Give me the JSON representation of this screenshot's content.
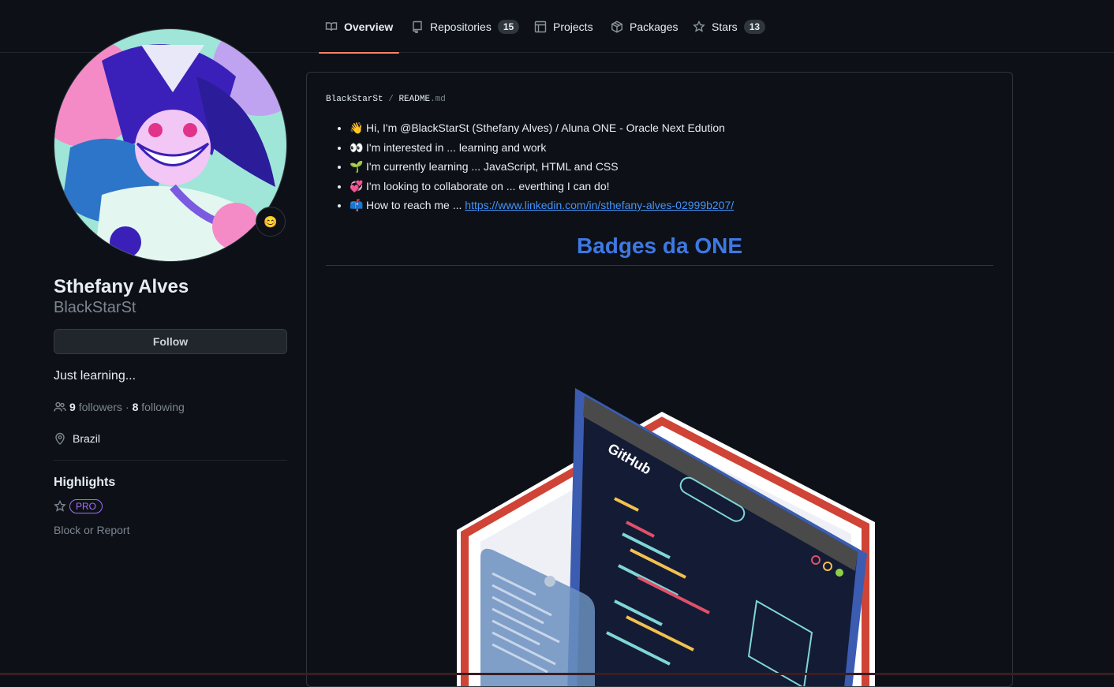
{
  "nav": {
    "tabs": [
      {
        "label": "Overview",
        "icon": "book-icon",
        "active": true
      },
      {
        "label": "Repositories",
        "icon": "repo-icon",
        "count": "15"
      },
      {
        "label": "Projects",
        "icon": "table-icon"
      },
      {
        "label": "Packages",
        "icon": "package-icon"
      },
      {
        "label": "Stars",
        "icon": "star-icon",
        "count": "13"
      }
    ]
  },
  "profile": {
    "name": "Sthefany Alves",
    "login": "BlackStarSt",
    "status_emoji": "😊",
    "follow_label": "Follow",
    "bio": "Just learning...",
    "followers_count": "9",
    "followers_label": "followers",
    "separator": "·",
    "following_count": "8",
    "following_label": "following",
    "location": "Brazil",
    "highlights_title": "Highlights",
    "pro_badge": "PRO",
    "block_label": "Block or Report"
  },
  "readme": {
    "owner": "BlackStarSt",
    "slash": "/",
    "file_name": "README",
    "file_ext": ".md",
    "items": [
      {
        "emoji": "👋",
        "text": "Hi, I'm @BlackStarSt (Sthefany Alves) / Aluna ONE - Oracle Next Edution"
      },
      {
        "emoji": "👀",
        "text": "I'm interested in ... learning and work"
      },
      {
        "emoji": "🌱",
        "text": "I'm currently learning ... JavaScript, HTML and CSS"
      },
      {
        "emoji": "💞️",
        "text": "I'm looking to collaborate on ... everthing I can do!"
      },
      {
        "emoji": "📫",
        "text": "How to reach me ... ",
        "link": "https://www.linkedin.com/in/sthefany-alves-02999b207/"
      }
    ],
    "badges_title": "Badges da ONE",
    "badge_logo_text": "GitHub"
  },
  "colors": {
    "background": "#0d1117",
    "active_tab_underline": "#f78166",
    "link": "#4493f8",
    "heading_blue": "#3e78e3",
    "pro_purple": "#a371f7"
  }
}
